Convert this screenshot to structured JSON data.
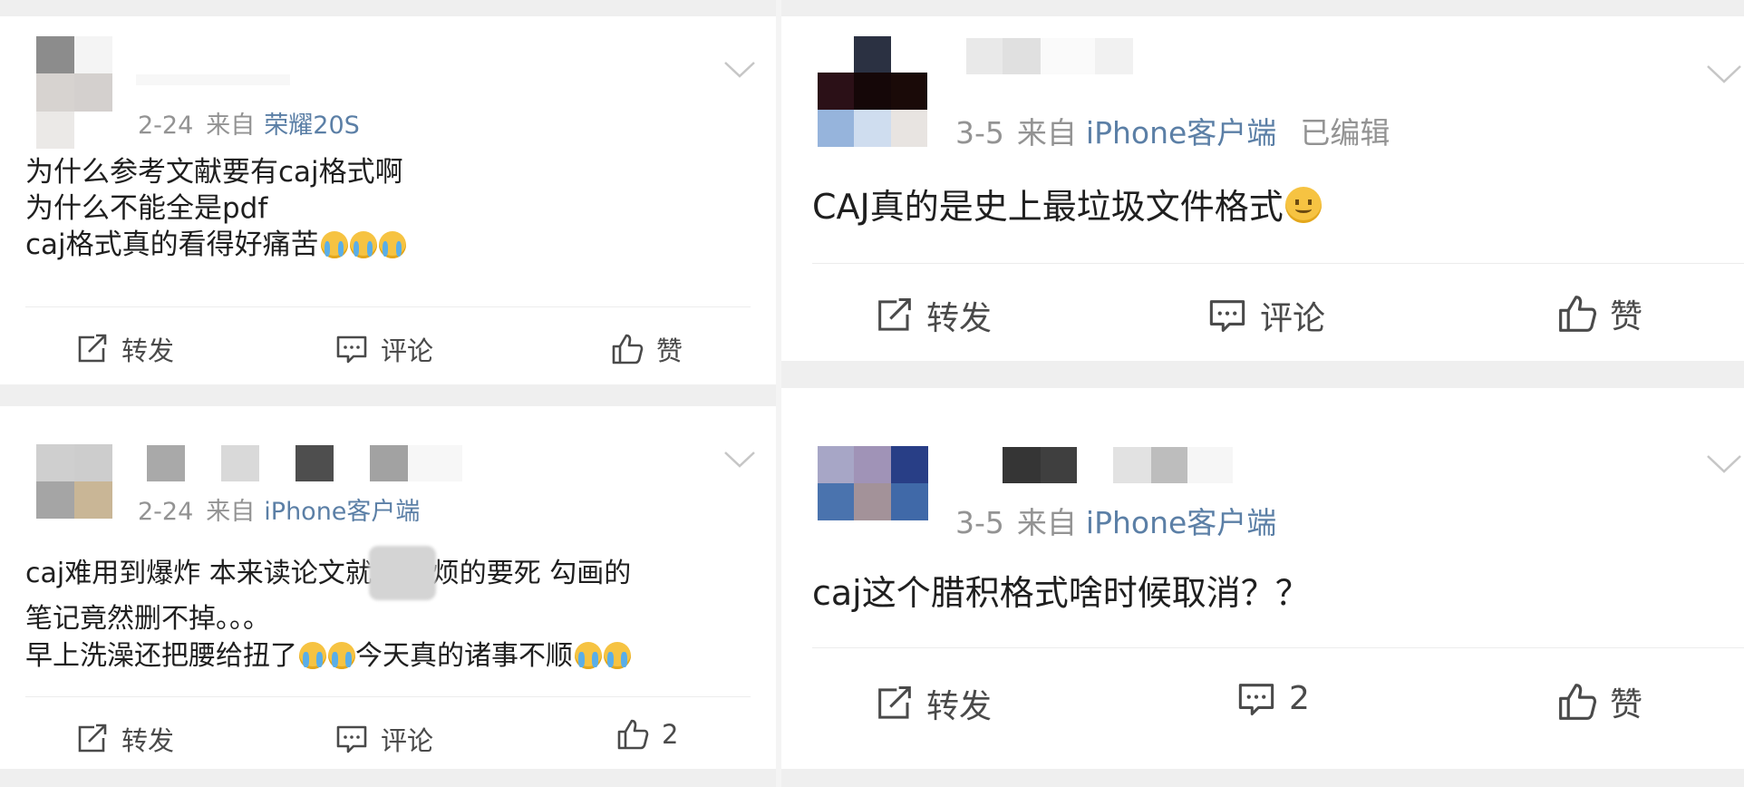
{
  "posts": [
    {
      "date": "2-24",
      "from_label": "来自",
      "source": "荣耀20S",
      "edited": "",
      "lines": [
        "为什么参考文献要有caj格式啊",
        "为什么不能全是pdf",
        "caj格式真的看得好痛苦"
      ],
      "emoji_note": "crying-face x3",
      "repost_label": "转发",
      "comment_label": "评论",
      "like_label": "赞"
    },
    {
      "date": "3-5",
      "from_label": "来自",
      "source": "iPhone客户端",
      "edited": "已编辑",
      "lines": [
        "CAJ真的是史上最垃圾文件格式"
      ],
      "emoji_note": "smiling-face",
      "repost_label": "转发",
      "comment_label": "评论",
      "like_label": "赞"
    },
    {
      "date": "2-24",
      "from_label": "来自",
      "source": "iPhone客户端",
      "edited": "",
      "line1_a": "caj难用到爆炸 本来读论文就",
      "line1_b": "烦的要死 勾画的",
      "line2": "笔记竟然删不掉。。。",
      "line3_a": "早上洗澡还把腰给扭了",
      "line3_b": "今天真的诸事不顺",
      "repost_label": "转发",
      "comment_label": "评论",
      "like_label": "2"
    },
    {
      "date": "3-5",
      "from_label": "来自",
      "source": "iPhone客户端",
      "edited": "",
      "lines": [
        "caj这个腊积格式啥时候取消？？"
      ],
      "repost_label": "转发",
      "comment_label": "2",
      "like_label": "赞"
    }
  ],
  "colors": {
    "background": "#efefef",
    "card": "#ffffff",
    "source_link": "#5b7fa6",
    "meta_gray": "#939393"
  },
  "icons": [
    "repost-icon",
    "comment-icon",
    "like-icon",
    "chevron-down-icon"
  ]
}
